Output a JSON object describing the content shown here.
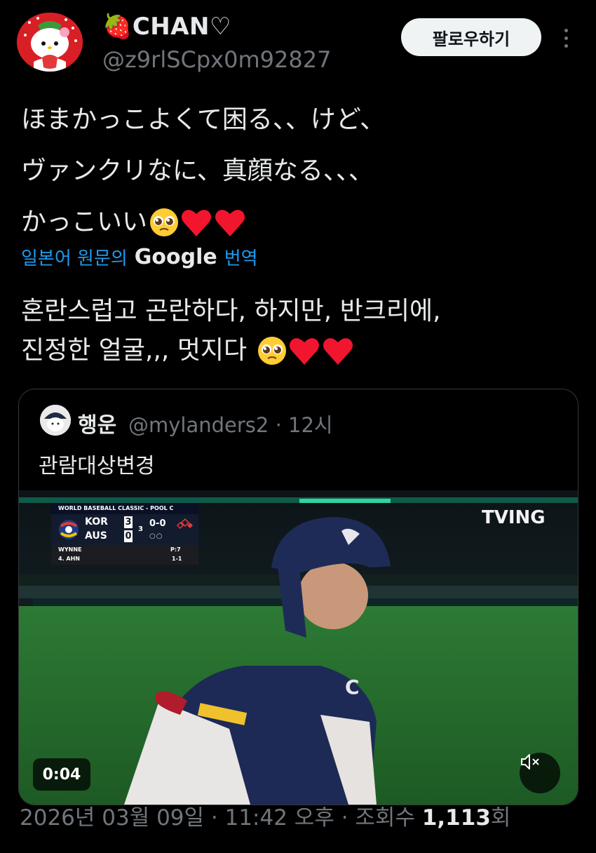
{
  "author": {
    "display_name": "🍓CHAN♡",
    "handle": "@z9rlSCpx0m92827",
    "avatar_icon": "hello-kitty-strawberry-avatar"
  },
  "actions": {
    "follow_label": "팔로우하기",
    "more_icon": "more-vertical-icon"
  },
  "tweet": {
    "lines": [
      "ほまかっこよくて困る、、けど、",
      "ヴァンクリなに、真顔なる、、、",
      "かっこいい"
    ],
    "emojis_line3": [
      "pleading-face-emoji",
      "red-heart-emoji",
      "red-heart-emoji"
    ]
  },
  "translation": {
    "link_prefix": "일본어 원문의",
    "brand": "Google",
    "link_suffix": "번역",
    "lines": [
      "혼란스럽고 곤란하다, 하지만, 반크리에,",
      "진정한 얼굴,,, 멋지다 "
    ]
  },
  "quoted": {
    "name": "행운",
    "meta": "@mylanders2 · 12시",
    "text": "관람대상변경",
    "video": {
      "duration": "0:04",
      "watermark": "TVING",
      "mute_icon": "volume-muted-icon",
      "scorebug": {
        "title": "WORLD BASEBALL CLASSIC - POOL C",
        "team1": "KOR",
        "score1": "3",
        "team2": "AUS",
        "score2": "0",
        "inning": "3",
        "count": "0-0",
        "outs": "○○",
        "pitcher": "WYNNE",
        "pitch_count": "P:7",
        "batter": "4. AHN",
        "batter_line": "1-1"
      }
    }
  },
  "footer": {
    "timestamp": "2026년 03월 09일 · 11:42 오후 · 조회수 ",
    "views": "1,113",
    "views_suffix": "회"
  },
  "colors": {
    "background": "#000000",
    "text": "#e7e9ea",
    "muted": "#71767b",
    "link": "#1d9bf0",
    "heart": "#f2152e"
  }
}
